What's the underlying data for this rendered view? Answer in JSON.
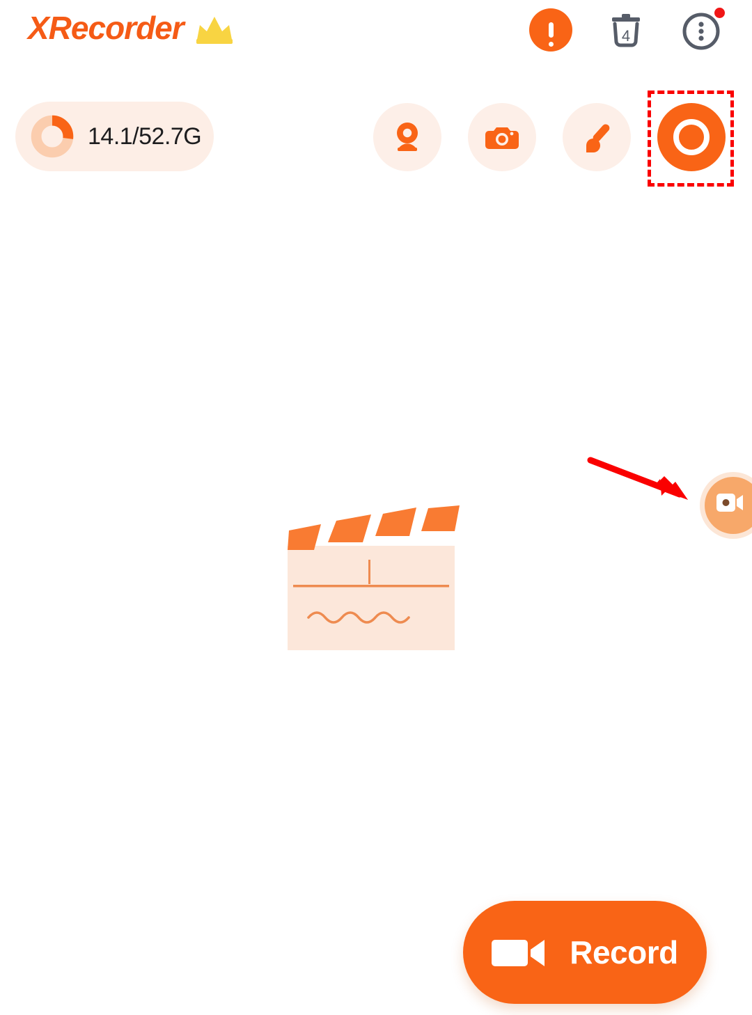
{
  "app": {
    "name": "XRecorder",
    "pro_badge_icon": "crown-icon",
    "accent_color": "#F96416",
    "accent_light_color": "#FDEEE6",
    "highlight_color": "#FA0000",
    "crown_color": "#F8D442"
  },
  "header": {
    "title": "XRecorder",
    "actions": [
      {
        "name": "alert-icon",
        "label": "!"
      },
      {
        "name": "trash-icon",
        "count": "4"
      },
      {
        "name": "more-menu-icon",
        "has_badge": true
      }
    ]
  },
  "toolbar": {
    "storage": {
      "text": "14.1/52.7G",
      "used": 14.1,
      "total": 52.7,
      "percent": 27
    },
    "tools": [
      {
        "name": "facecam-button",
        "icon": "webcam-icon"
      },
      {
        "name": "screenshot-button",
        "icon": "camera-icon"
      },
      {
        "name": "brush-button",
        "icon": "brush-icon"
      },
      {
        "name": "record-mode-button",
        "icon": "record-target-icon",
        "highlighted": true
      }
    ]
  },
  "main": {
    "empty_state_icon": "clapperboard-icon",
    "float_bubble": {
      "name": "floating-record-bubble",
      "icon": "camcorder-icon"
    },
    "annotation": {
      "name": "pointer-arrow",
      "color": "#FA0000"
    }
  },
  "footer": {
    "record_button": {
      "label": "Record",
      "icon": "video-camera-icon"
    }
  }
}
